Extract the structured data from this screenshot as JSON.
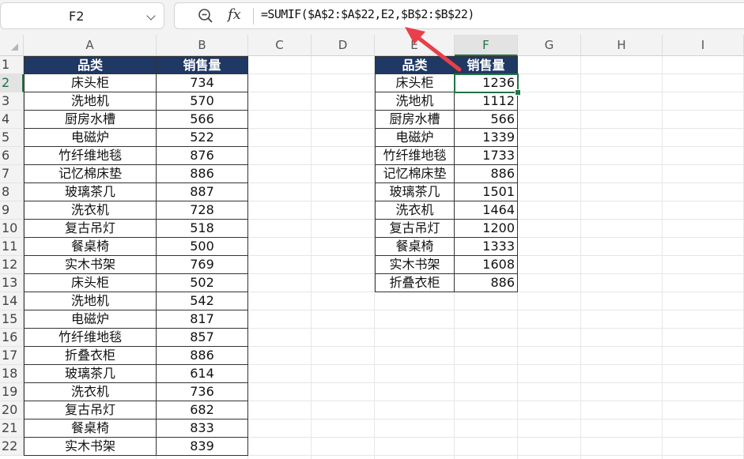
{
  "name_box": "F2",
  "formula": "=SUMIF($A$2:$A$22,E2,$B$2:$B$22)",
  "columns": [
    "A",
    "B",
    "C",
    "D",
    "E",
    "F",
    "G",
    "H",
    "I"
  ],
  "selected_column": "F",
  "rows": [
    "1",
    "2",
    "3",
    "4",
    "5",
    "6",
    "7",
    "8",
    "9",
    "10",
    "11",
    "12",
    "13",
    "14",
    "15",
    "16",
    "17",
    "18",
    "19",
    "20",
    "21",
    "22"
  ],
  "selected_row": "2",
  "table_left": {
    "headers": [
      "品类",
      "销售量"
    ],
    "rows": [
      [
        "床头柜",
        "734"
      ],
      [
        "洗地机",
        "570"
      ],
      [
        "厨房水槽",
        "566"
      ],
      [
        "电磁炉",
        "522"
      ],
      [
        "竹纤维地毯",
        "876"
      ],
      [
        "记忆棉床垫",
        "886"
      ],
      [
        "玻璃茶几",
        "887"
      ],
      [
        "洗衣机",
        "728"
      ],
      [
        "复古吊灯",
        "518"
      ],
      [
        "餐桌椅",
        "500"
      ],
      [
        "实木书架",
        "769"
      ],
      [
        "床头柜",
        "502"
      ],
      [
        "洗地机",
        "542"
      ],
      [
        "电磁炉",
        "817"
      ],
      [
        "竹纤维地毯",
        "857"
      ],
      [
        "折叠衣柜",
        "886"
      ],
      [
        "玻璃茶几",
        "614"
      ],
      [
        "洗衣机",
        "736"
      ],
      [
        "复古吊灯",
        "682"
      ],
      [
        "餐桌椅",
        "833"
      ],
      [
        "实木书架",
        "839"
      ]
    ]
  },
  "table_right": {
    "headers": [
      "品类",
      "销售量"
    ],
    "rows": [
      [
        "床头柜",
        "1236"
      ],
      [
        "洗地机",
        "1112"
      ],
      [
        "厨房水槽",
        "566"
      ],
      [
        "电磁炉",
        "1339"
      ],
      [
        "竹纤维地毯",
        "1733"
      ],
      [
        "记忆棉床垫",
        "886"
      ],
      [
        "玻璃茶几",
        "1501"
      ],
      [
        "洗衣机",
        "1464"
      ],
      [
        "复古吊灯",
        "1200"
      ],
      [
        "餐桌椅",
        "1333"
      ],
      [
        "实木书架",
        "1608"
      ],
      [
        "折叠衣柜",
        "886"
      ]
    ]
  },
  "colors": {
    "header_fill": "#1f3864",
    "selection": "#217346",
    "arrow": "#e8404a"
  },
  "icons": {
    "name_box_dropdown": "chevron-down-icon",
    "zoom": "zoom-icon",
    "function": "fx-icon"
  }
}
